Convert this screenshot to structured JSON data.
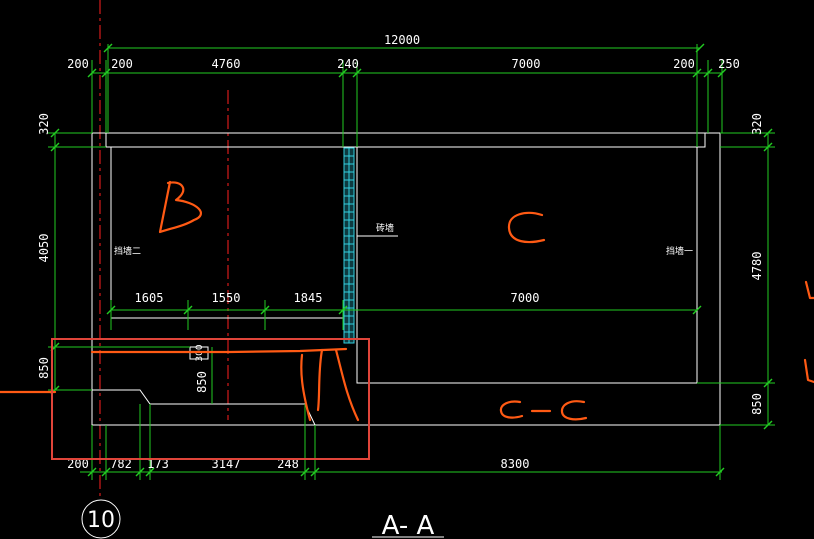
{
  "drawing": {
    "section_title": "A- A",
    "grid_bubble": "10",
    "colors": {
      "dimension": "#22cc22",
      "outline": "#ffffff",
      "centerline": "#ff2020",
      "handwriting": "#ff5a14",
      "highlight_box": "#e0453a",
      "wall_hatch": "#33d0e0"
    }
  },
  "top_dimensions": {
    "overall": "12000",
    "segments": [
      "200",
      "200",
      "4760",
      "240",
      "7000",
      "200",
      "250"
    ]
  },
  "left_dimensions": [
    "320",
    "4050",
    "850"
  ],
  "right_dimensions": [
    "320",
    "4780",
    "850"
  ],
  "inner_dimensions": {
    "segments": [
      "1605",
      "1550",
      "1845",
      "7000"
    ],
    "step_height": "850",
    "small_height": "300"
  },
  "bottom_dimensions": [
    "200",
    "782",
    "173",
    "3147",
    "248",
    "8300"
  ],
  "wall_labels": {
    "left": "挡墙二",
    "middle": "砖墙",
    "right": "挡墙一"
  },
  "handwritten_marks": {
    "room_b": "B",
    "room_c": "C",
    "section_cc": "C- C"
  }
}
